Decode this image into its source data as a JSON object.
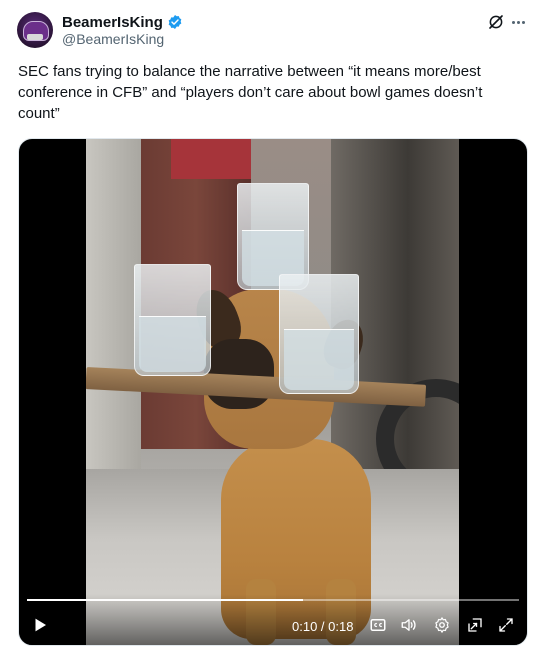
{
  "author": {
    "display_name": "BeamerIsKing",
    "handle": "@BeamerIsKing",
    "verified": true,
    "verified_color": "#1d9bf0"
  },
  "header_icons": [
    "grok-icon",
    "more-icon"
  ],
  "tweet": {
    "text": "SEC fans trying to balance the narrative between “it means more/best conference in CFB” and “players don’t care about bowl games doesn’t count”"
  },
  "video": {
    "current_time": "0:10",
    "duration": "0:18",
    "time_label": "0:10 / 0:18",
    "progress": 0.56,
    "controls": [
      "play-icon",
      "captions-icon",
      "volume-icon",
      "settings-icon",
      "pip-icon",
      "fullscreen-icon"
    ]
  },
  "colors": {
    "text_primary": "#0f1419",
    "text_secondary": "#536471",
    "accent": "#1d9bf0"
  }
}
